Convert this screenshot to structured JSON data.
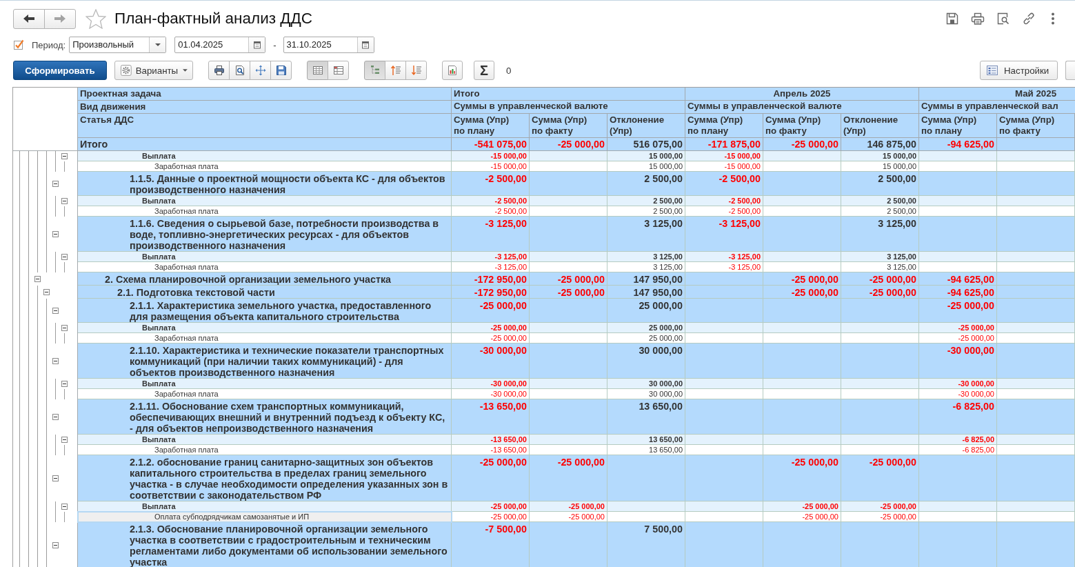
{
  "window": {
    "title": "План-фактный анализ ДДС",
    "favorite": false
  },
  "history_buttons": [
    {
      "disabled": false
    },
    {
      "disabled": true
    }
  ],
  "period": {
    "checked": true,
    "label": "Период:",
    "type": "Произвольный",
    "date_from": "01.04.2025",
    "separator": "-",
    "date_to": "31.10.2025"
  },
  "toolbar": {
    "generate_button": "Сформировать",
    "variants_button": "Варианты",
    "view_toggles": [
      {
        "pressed": true
      },
      {
        "pressed": false
      }
    ],
    "grouping_toggles": [
      {
        "pressed": true
      },
      {
        "pressed": false
      },
      {
        "pressed": false
      }
    ],
    "sum_button": "Σ",
    "sum_value": "0",
    "settings_button": "Настройки"
  },
  "table": {
    "row_headers": [
      "Проектная задача",
      "Вид движения",
      "Статья ДДС"
    ],
    "column_groups": [
      {
        "kind": "total",
        "title": "Итого",
        "subtitle": "Суммы в управленческой валюте",
        "columns": [
          "Сумма (Упр)\nпо плану",
          "Сумма (Упр)\nпо факту",
          "Отклонение\n(Упр)"
        ]
      },
      {
        "kind": "period",
        "title": "Апрель 2025",
        "subtitle": "Суммы в управленческой валюте",
        "columns": [
          "Сумма (Упр)\nпо плану",
          "Сумма (Упр)\nпо факту",
          "Отклонение\n(Упр)"
        ]
      },
      {
        "kind": "period",
        "title": "Май 2025",
        "subtitle": "Суммы в управленческой вал",
        "columns": [
          "Сумма (Упр)\nпо плану",
          "Сумма (Упр)\nпо факту"
        ]
      }
    ],
    "total_row": {
      "label": "Итого",
      "amounts": {
        "total": {
          "plan": {
            "text": "-541 075,00",
            "negative": true
          },
          "fact": {
            "text": "-25 000,00",
            "negative": true
          },
          "deviation": {
            "text": "516 075,00",
            "negative": false
          }
        },
        "april": {
          "plan": {
            "text": "-171 875,00",
            "negative": true
          },
          "fact": {
            "text": "-25 000,00",
            "negative": true
          },
          "deviation": {
            "text": "146 875,00",
            "negative": false
          }
        },
        "may": {
          "plan": {
            "text": "-94 625,00",
            "negative": true
          }
        }
      }
    },
    "rows": [
      {
        "children": [
          {
            "children": [
              {
                "children": [
                  {
                    "children": [
                      {
                        "label": "Выплата",
                        "kind": "movement",
                        "selected": false,
                        "expanded": true,
                        "amounts": {
                          "total": {
                            "plan": {
                              "text": "-15 000,00",
                              "negative": true
                            },
                            "deviation": {
                              "text": "15 000,00",
                              "negative": false
                            }
                          },
                          "april": {
                            "plan": {
                              "text": "-15 000,00",
                              "negative": true
                            },
                            "deviation": {
                              "text": "15 000,00",
                              "negative": false
                            }
                          }
                        },
                        "children": [
                          {
                            "label": "Заработная плата",
                            "kind": "article",
                            "selected": false,
                            "amounts": {
                              "total": {
                                "plan": {
                                  "text": "-15 000,00",
                                  "negative": true
                                },
                                "deviation": {
                                  "text": "15 000,00",
                                  "negative": false
                                }
                              },
                              "april": {
                                "plan": {
                                  "text": "-15 000,00",
                                  "negative": true
                                },
                                "deviation": {
                                  "text": "15 000,00",
                                  "negative": false
                                }
                              }
                            }
                          }
                        ]
                      }
                    ]
                  },
                  {
                    "label": "1.1.5. Данные о проектной мощности объекта КС - для объектов производственного назначения",
                    "kind": "section",
                    "selected": false,
                    "expanded": true,
                    "amounts": {
                      "total": {
                        "plan": {
                          "text": "-2 500,00",
                          "negative": true
                        },
                        "deviation": {
                          "text": "2 500,00",
                          "negative": false
                        }
                      },
                      "april": {
                        "plan": {
                          "text": "-2 500,00",
                          "negative": true
                        },
                        "deviation": {
                          "text": "2 500,00",
                          "negative": false
                        }
                      }
                    },
                    "children": [
                      {
                        "label": "Выплата",
                        "kind": "movement",
                        "selected": false,
                        "expanded": true,
                        "amounts": {
                          "total": {
                            "plan": {
                              "text": "-2 500,00",
                              "negative": true
                            },
                            "deviation": {
                              "text": "2 500,00",
                              "negative": false
                            }
                          },
                          "april": {
                            "plan": {
                              "text": "-2 500,00",
                              "negative": true
                            },
                            "deviation": {
                              "text": "2 500,00",
                              "negative": false
                            }
                          }
                        },
                        "children": [
                          {
                            "label": "Заработная плата",
                            "kind": "article",
                            "selected": false,
                            "amounts": {
                              "total": {
                                "plan": {
                                  "text": "-2 500,00",
                                  "negative": true
                                },
                                "deviation": {
                                  "text": "2 500,00",
                                  "negative": false
                                }
                              },
                              "april": {
                                "plan": {
                                  "text": "-2 500,00",
                                  "negative": true
                                },
                                "deviation": {
                                  "text": "2 500,00",
                                  "negative": false
                                }
                              }
                            }
                          }
                        ]
                      }
                    ]
                  },
                  {
                    "label": "1.1.6. Сведения о сырьевой базе, потребности производства в воде, топливно-энергетических ресурсах - для объектов производственного назначения",
                    "kind": "section",
                    "selected": false,
                    "expanded": true,
                    "amounts": {
                      "total": {
                        "plan": {
                          "text": "-3 125,00",
                          "negative": true
                        },
                        "deviation": {
                          "text": "3 125,00",
                          "negative": false
                        }
                      },
                      "april": {
                        "plan": {
                          "text": "-3 125,00",
                          "negative": true
                        },
                        "deviation": {
                          "text": "3 125,00",
                          "negative": false
                        }
                      }
                    },
                    "children": [
                      {
                        "label": "Выплата",
                        "kind": "movement",
                        "selected": false,
                        "expanded": true,
                        "amounts": {
                          "total": {
                            "plan": {
                              "text": "-3 125,00",
                              "negative": true
                            },
                            "deviation": {
                              "text": "3 125,00",
                              "negative": false
                            }
                          },
                          "april": {
                            "plan": {
                              "text": "-3 125,00",
                              "negative": true
                            },
                            "deviation": {
                              "text": "3 125,00",
                              "negative": false
                            }
                          }
                        },
                        "children": [
                          {
                            "label": "Заработная плата",
                            "kind": "article",
                            "selected": false,
                            "amounts": {
                              "total": {
                                "plan": {
                                  "text": "-3 125,00",
                                  "negative": true
                                },
                                "deviation": {
                                  "text": "3 125,00",
                                  "negative": false
                                }
                              },
                              "april": {
                                "plan": {
                                  "text": "-3 125,00",
                                  "negative": true
                                },
                                "deviation": {
                                  "text": "3 125,00",
                                  "negative": false
                                }
                              }
                            }
                          }
                        ]
                      }
                    ]
                  }
                ]
              }
            ]
          },
          {
            "label": "2. Схема планировочной организации земельного участка",
            "kind": "section",
            "selected": false,
            "expanded": true,
            "amounts": {
              "total": {
                "plan": {
                  "text": "-172 950,00",
                  "negative": true
                },
                "fact": {
                  "text": "-25 000,00",
                  "negative": true
                },
                "deviation": {
                  "text": "147 950,00",
                  "negative": false
                }
              },
              "april": {
                "fact": {
                  "text": "-25 000,00",
                  "negative": true
                },
                "deviation": {
                  "text": "-25 000,00",
                  "negative": true
                }
              },
              "may": {
                "plan": {
                  "text": "-94 625,00",
                  "negative": true
                }
              }
            },
            "children": [
              {
                "label": "2.1. Подготовка текстовой части",
                "kind": "section",
                "selected": false,
                "expanded": true,
                "amounts": {
                  "total": {
                    "plan": {
                      "text": "-172 950,00",
                      "negative": true
                    },
                    "fact": {
                      "text": "-25 000,00",
                      "negative": true
                    },
                    "deviation": {
                      "text": "147 950,00",
                      "negative": false
                    }
                  },
                  "april": {
                    "fact": {
                      "text": "-25 000,00",
                      "negative": true
                    },
                    "deviation": {
                      "text": "-25 000,00",
                      "negative": true
                    }
                  },
                  "may": {
                    "plan": {
                      "text": "-94 625,00",
                      "negative": true
                    }
                  }
                },
                "children": [
                  {
                    "label": "2.1.1. Характеристика земельного участка, предоставленного для размещения объекта капитального строительства",
                    "kind": "section",
                    "selected": false,
                    "expanded": true,
                    "amounts": {
                      "total": {
                        "plan": {
                          "text": "-25 000,00",
                          "negative": true
                        },
                        "deviation": {
                          "text": "25 000,00",
                          "negative": false
                        }
                      },
                      "may": {
                        "plan": {
                          "text": "-25 000,00",
                          "negative": true
                        }
                      }
                    },
                    "children": [
                      {
                        "label": "Выплата",
                        "kind": "movement",
                        "selected": false,
                        "expanded": true,
                        "amounts": {
                          "total": {
                            "plan": {
                              "text": "-25 000,00",
                              "negative": true
                            },
                            "deviation": {
                              "text": "25 000,00",
                              "negative": false
                            }
                          },
                          "may": {
                            "plan": {
                              "text": "-25 000,00",
                              "negative": true
                            }
                          }
                        },
                        "children": [
                          {
                            "label": "Заработная плата",
                            "kind": "article",
                            "selected": false,
                            "amounts": {
                              "total": {
                                "plan": {
                                  "text": "-25 000,00",
                                  "negative": true
                                },
                                "deviation": {
                                  "text": "25 000,00",
                                  "negative": false
                                }
                              },
                              "may": {
                                "plan": {
                                  "text": "-25 000,00",
                                  "negative": true
                                }
                              }
                            }
                          }
                        ]
                      }
                    ]
                  },
                  {
                    "label": "2.1.10. Характеристика и технические показатели транспортных коммуникаций (при наличии таких коммуникаций) - для объектов производственного назначения",
                    "kind": "section",
                    "selected": false,
                    "expanded": true,
                    "amounts": {
                      "total": {
                        "plan": {
                          "text": "-30 000,00",
                          "negative": true
                        },
                        "deviation": {
                          "text": "30 000,00",
                          "negative": false
                        }
                      },
                      "may": {
                        "plan": {
                          "text": "-30 000,00",
                          "negative": true
                        }
                      }
                    },
                    "children": [
                      {
                        "label": "Выплата",
                        "kind": "movement",
                        "selected": false,
                        "expanded": true,
                        "amounts": {
                          "total": {
                            "plan": {
                              "text": "-30 000,00",
                              "negative": true
                            },
                            "deviation": {
                              "text": "30 000,00",
                              "negative": false
                            }
                          },
                          "may": {
                            "plan": {
                              "text": "-30 000,00",
                              "negative": true
                            }
                          }
                        },
                        "children": [
                          {
                            "label": "Заработная плата",
                            "kind": "article",
                            "selected": false,
                            "amounts": {
                              "total": {
                                "plan": {
                                  "text": "-30 000,00",
                                  "negative": true
                                },
                                "deviation": {
                                  "text": "30 000,00",
                                  "negative": false
                                }
                              },
                              "may": {
                                "plan": {
                                  "text": "-30 000,00",
                                  "negative": true
                                }
                              }
                            }
                          }
                        ]
                      }
                    ]
                  },
                  {
                    "label": "2.1.11. Обоснование схем транспортных коммуникаций, обеспечивающих внешний и внутренний подъезд к объекту КС, - для объектов непроизводственного назначения",
                    "kind": "section",
                    "selected": false,
                    "expanded": true,
                    "amounts": {
                      "total": {
                        "plan": {
                          "text": "-13 650,00",
                          "negative": true
                        },
                        "deviation": {
                          "text": "13 650,00",
                          "negative": false
                        }
                      },
                      "may": {
                        "plan": {
                          "text": "-6 825,00",
                          "negative": true
                        }
                      }
                    },
                    "children": [
                      {
                        "label": "Выплата",
                        "kind": "movement",
                        "selected": false,
                        "expanded": true,
                        "amounts": {
                          "total": {
                            "plan": {
                              "text": "-13 650,00",
                              "negative": true
                            },
                            "deviation": {
                              "text": "13 650,00",
                              "negative": false
                            }
                          },
                          "may": {
                            "plan": {
                              "text": "-6 825,00",
                              "negative": true
                            }
                          }
                        },
                        "children": [
                          {
                            "label": "Заработная плата",
                            "kind": "article",
                            "selected": false,
                            "amounts": {
                              "total": {
                                "plan": {
                                  "text": "-13 650,00",
                                  "negative": true
                                },
                                "deviation": {
                                  "text": "13 650,00",
                                  "negative": false
                                }
                              },
                              "may": {
                                "plan": {
                                  "text": "-6 825,00",
                                  "negative": true
                                }
                              }
                            }
                          }
                        ]
                      }
                    ]
                  },
                  {
                    "label": "2.1.2. обоснование границ санитарно-защитных зон объектов капитального строительства в пределах границ земельного участка - в случае необходимости определения указанных зон в соответствии с законодательством РФ",
                    "kind": "section",
                    "selected": false,
                    "expanded": true,
                    "amounts": {
                      "total": {
                        "plan": {
                          "text": "-25 000,00",
                          "negative": true
                        },
                        "fact": {
                          "text": "-25 000,00",
                          "negative": true
                        }
                      },
                      "april": {
                        "fact": {
                          "text": "-25 000,00",
                          "negative": true
                        },
                        "deviation": {
                          "text": "-25 000,00",
                          "negative": true
                        }
                      }
                    },
                    "children": [
                      {
                        "label": "Выплата",
                        "kind": "movement",
                        "selected": false,
                        "expanded": true,
                        "amounts": {
                          "total": {
                            "plan": {
                              "text": "-25 000,00",
                              "negative": true
                            },
                            "fact": {
                              "text": "-25 000,00",
                              "negative": true
                            }
                          },
                          "april": {
                            "fact": {
                              "text": "-25 000,00",
                              "negative": true
                            },
                            "deviation": {
                              "text": "-25 000,00",
                              "negative": true
                            }
                          }
                        },
                        "children": [
                          {
                            "label": "Оплата субподрядчикам самозанятые и ИП",
                            "kind": "article",
                            "selected": true,
                            "amounts": {
                              "total": {
                                "plan": {
                                  "text": "-25 000,00",
                                  "negative": true
                                },
                                "fact": {
                                  "text": "-25 000,00",
                                  "negative": true
                                }
                              },
                              "april": {
                                "fact": {
                                  "text": "-25 000,00",
                                  "negative": true
                                },
                                "deviation": {
                                  "text": "-25 000,00",
                                  "negative": true
                                }
                              }
                            }
                          }
                        ]
                      }
                    ]
                  },
                  {
                    "label": "2.1.3. Обоснование планировочной организации земельного участка в соответствии с градостроительным и техническим регламентами либо документами об использовании земельного участка",
                    "kind": "section",
                    "selected": false,
                    "expanded": true,
                    "amounts": {
                      "total": {
                        "plan": {
                          "text": "-7 500,00",
                          "negative": true
                        },
                        "deviation": {
                          "text": "7 500,00",
                          "negative": false
                        }
                      }
                    }
                  }
                ]
              }
            ]
          }
        ]
      }
    ]
  }
}
